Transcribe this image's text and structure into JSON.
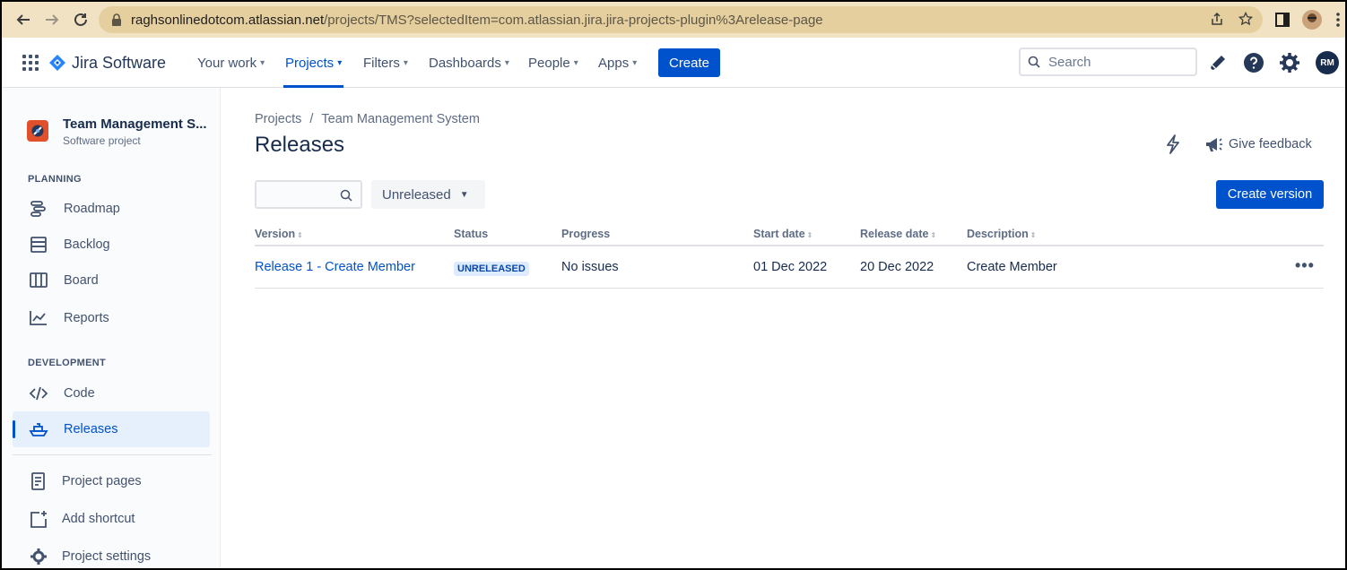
{
  "browser": {
    "url_host": "raghsonlinedotcom.atlassian.net",
    "url_path": "/projects/TMS?selectedItem=com.atlassian.jira.jira-projects-plugin%3Arelease-page"
  },
  "topnav": {
    "logo_text": "Jira Software",
    "menu": [
      "Your work",
      "Projects",
      "Filters",
      "Dashboards",
      "People",
      "Apps"
    ],
    "active_menu": "Projects",
    "create_label": "Create",
    "search_placeholder": "Search",
    "avatar_initials": "RM"
  },
  "sidebar": {
    "project_name": "Team Management S...",
    "project_type": "Software project",
    "planning_heading": "PLANNING",
    "planning_items": [
      "Roadmap",
      "Backlog",
      "Board",
      "Reports"
    ],
    "development_heading": "DEVELOPMENT",
    "development_items": [
      "Code",
      "Releases"
    ],
    "active_item": "Releases",
    "bottom_items": [
      "Project pages",
      "Add shortcut",
      "Project settings"
    ]
  },
  "main": {
    "breadcrumb": [
      "Projects",
      "Team Management System"
    ],
    "title": "Releases",
    "give_feedback": "Give feedback",
    "status_filter": "Unreleased",
    "create_version": "Create version",
    "columns": [
      "Version",
      "Status",
      "Progress",
      "Start date",
      "Release date",
      "Description"
    ],
    "rows": [
      {
        "version": "Release 1 - Create Member",
        "status": "UNRELEASED",
        "progress": "No issues",
        "start_date": "01 Dec 2022",
        "release_date": "20 Dec 2022",
        "description": "Create Member"
      }
    ]
  },
  "colors": {
    "brand_blue": "#0052cc",
    "browser_bar": "#f1e2c4",
    "lozenge_bg": "#deebff"
  }
}
